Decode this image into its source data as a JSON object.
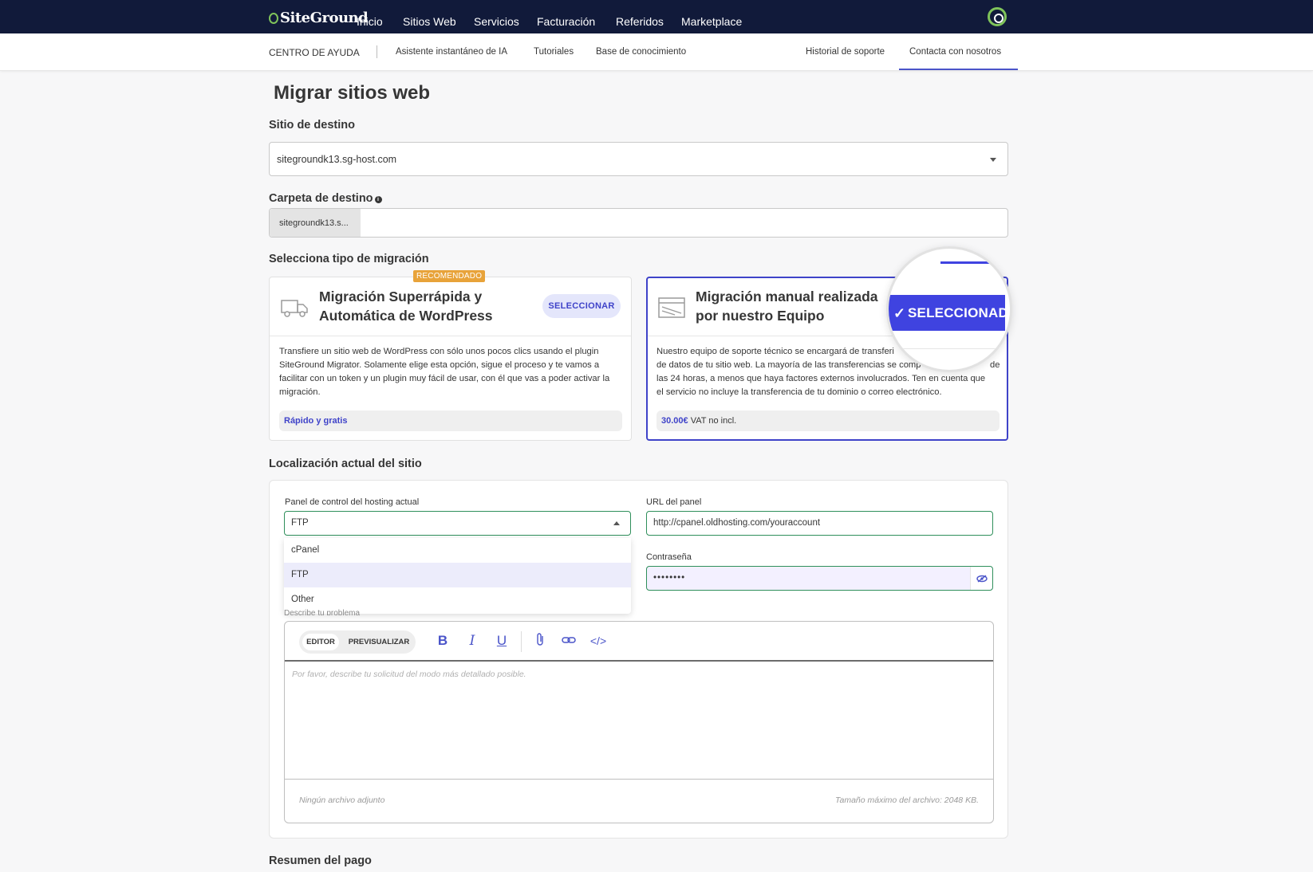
{
  "topnav": {
    "logo": "SiteGround",
    "items": [
      "Inicio",
      "Sitios Web",
      "Servicios",
      "Facturación",
      "Referidos",
      "Marketplace"
    ]
  },
  "subnav": {
    "section": "CENTRO DE AYUDA",
    "items": [
      "Asistente instantáneo de IA",
      "Tutoriales",
      "Base de conocimiento"
    ],
    "right_items": [
      "Historial de soporte",
      "Contacta con nosotros"
    ]
  },
  "page": {
    "title": "Migrar sitios web"
  },
  "destination": {
    "label": "Sitio de destino",
    "value": "sitegroundk13.sg-host.com"
  },
  "folder": {
    "label": "Carpeta de destino",
    "prefix": "sitegroundk13.s...",
    "value": ""
  },
  "migration": {
    "label": "Selecciona tipo de migración",
    "badge": "RECOMENDADO",
    "auto": {
      "title_line1": "Migración Superrápida y",
      "title_line2": "Automática de WordPress",
      "button": "SELECCIONAR",
      "description": "Transfiere un sitio web de WordPress con sólo unos pocos clics usando el plugin SiteGround Migrator. Solamente elige esta opción, sigue el proceso y te vamos a facilitar con un token y un plugin muy fácil de usar, con él que vas a poder activar la migración.",
      "footer": "Rápido y gratis"
    },
    "manual": {
      "title_line1": "Migración manual realizada",
      "title_line2": "por nuestro Equipo",
      "button": "SELECCIONADO",
      "description": "Nuestro equipo de soporte técnico se encargará de transferi… de datos de tu sitio web. La mayoría de las transferencias se comp… de las 24 horas, a menos que haya factores externos involucrados. Ten en cuenta que el servicio no incluye la transferencia de tu dominio o correo electrónico.",
      "desc_line1": "Nuestro equipo de soporte técnico se encargará de transferi",
      "desc_line2": "de datos de tu sitio web. La mayoría de las transferencias se comp",
      "desc_line2_tail": "de",
      "desc_line3": "las 24 horas, a menos que haya factores externos involucrados. Ten en cuenta que",
      "desc_line4": "el servicio no incluye la transferencia de tu dominio o correo electrónico.",
      "price": "30.00€",
      "price_note": "VAT no incl."
    }
  },
  "location": {
    "label": "Localización actual del sitio",
    "panel_label": "Panel de control del hosting actual",
    "panel_value": "FTP",
    "options": [
      "cPanel",
      "FTP",
      "Other"
    ],
    "selected_option": "FTP",
    "url_label": "URL del panel",
    "url_value": "http://cpanel.oldhosting.com/youraccount",
    "password_label": "Contraseña",
    "password_value": "••••••••",
    "describe_label": "Describe tu problema"
  },
  "editor": {
    "tab_editor": "EDITOR",
    "tab_preview": "PREVISUALIZAR",
    "placeholder": "Por favor, describe tu solicitud del modo más detallado posible.",
    "no_attachment": "Ningún archivo adjunto",
    "max_size": "Tamaño máximo del archivo: 2048 KB."
  },
  "summary": {
    "label": "Resumen del pago"
  },
  "colors": {
    "nav_bg": "#111a3a",
    "accent": "#3f43c9",
    "badge": "#e8a33a",
    "valid_border": "#2f8f5b"
  }
}
